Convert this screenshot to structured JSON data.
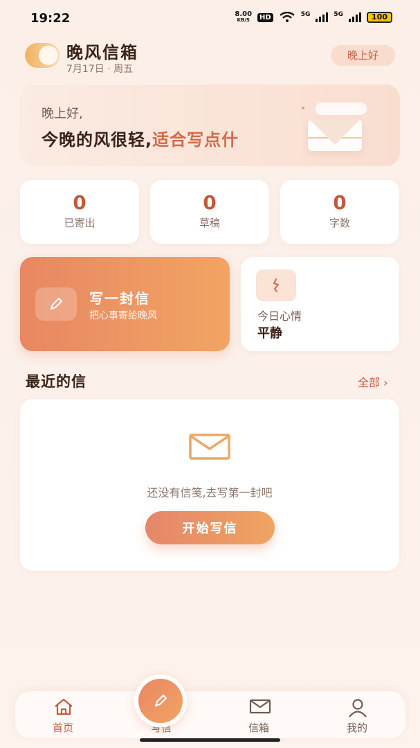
{
  "status_bar": {
    "time": "19:22",
    "net_speed_value": "8.00",
    "net_speed_unit": "KB/S",
    "hd": "HD",
    "signal1": "5G",
    "signal2": "5G",
    "battery": "100"
  },
  "header": {
    "title": "晚风信箱",
    "date": "7月17日 · 周五",
    "greeting_chip": "晚上好"
  },
  "banner": {
    "sub": "晚上好,",
    "main_prefix": "今晚的风很轻,",
    "main_accent": "适合写点什"
  },
  "stats": [
    {
      "value": "0",
      "label": "已寄出"
    },
    {
      "value": "0",
      "label": "草稿"
    },
    {
      "value": "0",
      "label": "字数"
    }
  ],
  "write_card": {
    "title": "写一封信",
    "subtitle": "把心事寄给晚风"
  },
  "mood_card": {
    "label": "今日心情",
    "value": "平静"
  },
  "recent": {
    "title": "最近的信",
    "all_link": "全部 ›",
    "empty_text": "还没有信笺,去写第一封吧",
    "start_button": "开始写信"
  },
  "tab_bar": {
    "items": [
      {
        "label": "首页",
        "icon": "home-icon",
        "active": true
      },
      {
        "label": "写信",
        "icon": "pencil-icon"
      },
      {
        "label": "信箱",
        "icon": "mail-icon"
      },
      {
        "label": "我的",
        "icon": "user-icon"
      }
    ]
  },
  "colors": {
    "accent": "#c2593b",
    "gradient_start": "#e88763",
    "gradient_end": "#f2a463",
    "background": "#fcefe7"
  }
}
